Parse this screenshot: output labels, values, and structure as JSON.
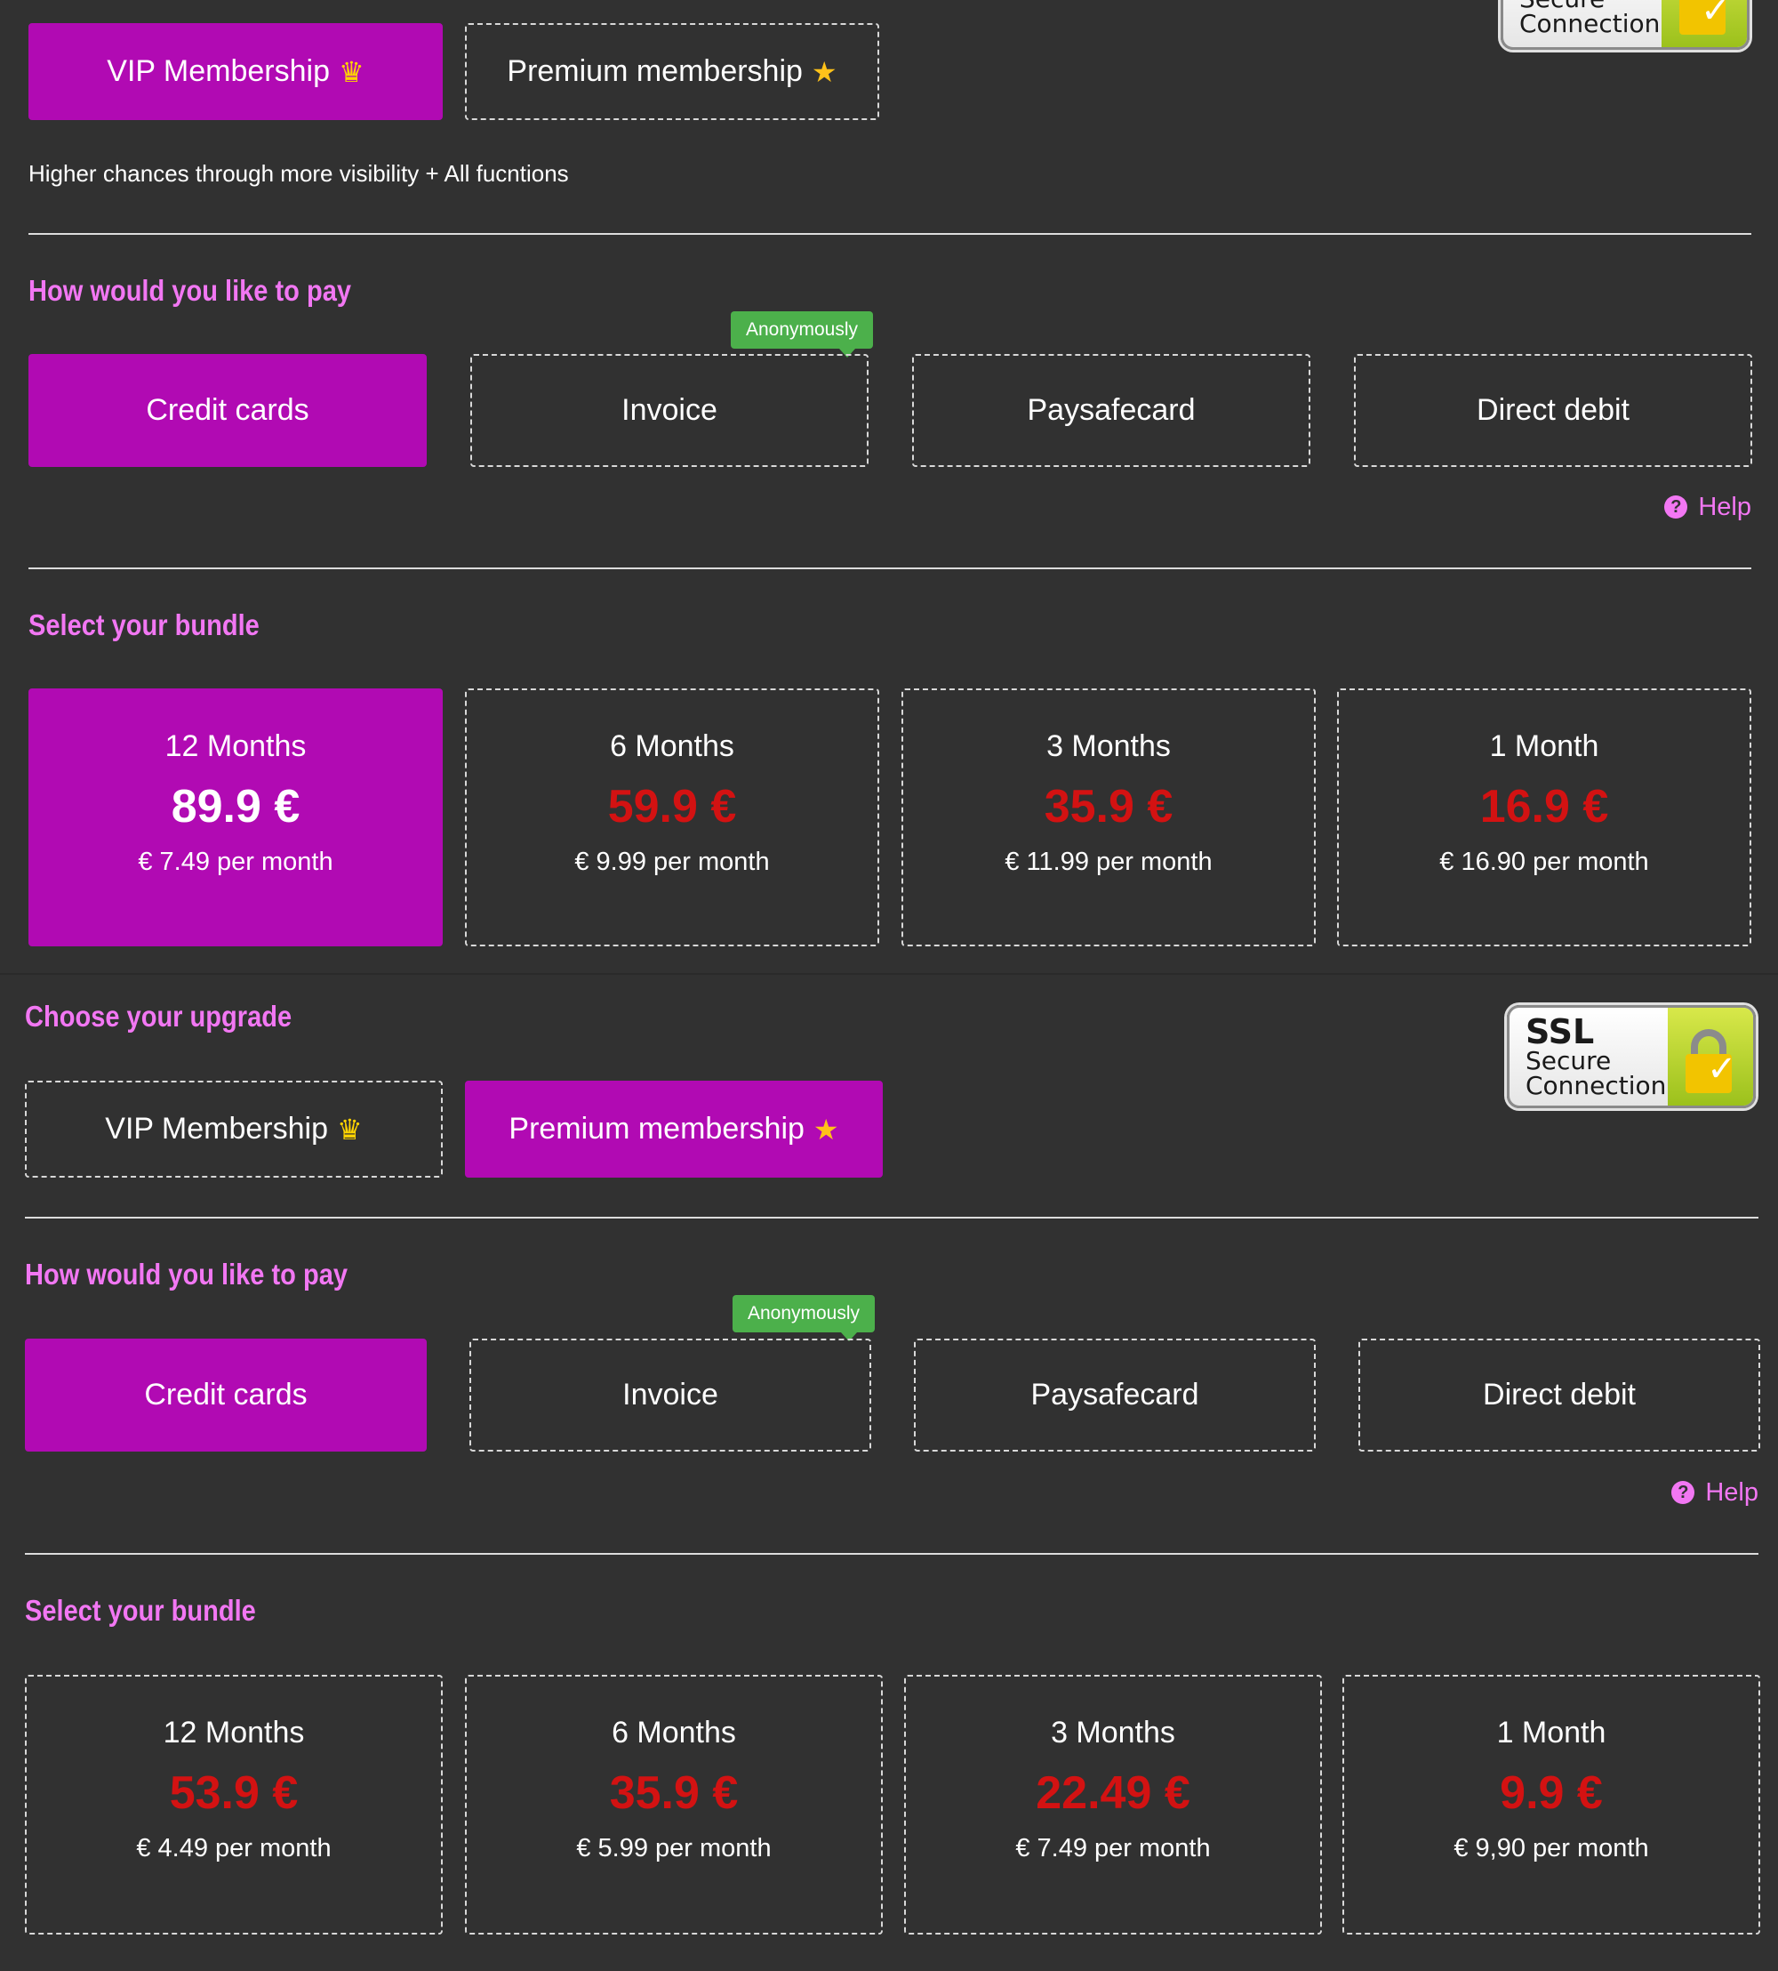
{
  "top": {
    "membership": {
      "vip_label": "VIP Membership",
      "premium_label": "Premium membership",
      "description": "Higher chances through more visibility + All fucntions"
    },
    "ssl": {
      "line2": "Secure",
      "line3": "Connection"
    },
    "payment": {
      "title": "How would you like to pay",
      "badge": "Anonymously",
      "options": [
        "Credit cards",
        "Invoice",
        "Paysafecard",
        "Direct debit"
      ],
      "help": "Help"
    },
    "bundle": {
      "title": "Select your bundle",
      "items": [
        {
          "months": "12 Months",
          "price": "89.9 €",
          "per_month": "€ 7.49 per month"
        },
        {
          "months": "6 Months",
          "price": "59.9 €",
          "per_month": "€ 9.99 per month"
        },
        {
          "months": "3 Months",
          "price": "35.9 €",
          "per_month": "€ 11.99 per month"
        },
        {
          "months": "1 Month",
          "price": "16.9 €",
          "per_month": "€ 16.90 per month"
        }
      ]
    }
  },
  "bottom": {
    "upgrade_title": "Choose your upgrade",
    "membership": {
      "vip_label": "VIP Membership",
      "premium_label": "Premium membership"
    },
    "ssl": {
      "line1": "SSL",
      "line2": "Secure",
      "line3": "Connection"
    },
    "payment": {
      "title": "How would you like to pay",
      "badge": "Anonymously",
      "options": [
        "Credit cards",
        "Invoice",
        "Paysafecard",
        "Direct debit"
      ],
      "help": "Help"
    },
    "bundle": {
      "title": "Select your bundle",
      "items": [
        {
          "months": "12 Months",
          "price": "53.9 €",
          "per_month": "€ 4.49 per month"
        },
        {
          "months": "6 Months",
          "price": "35.9 €",
          "per_month": "€ 5.99 per month"
        },
        {
          "months": "3 Months",
          "price": "22.49 €",
          "per_month": "€ 7.49 per month"
        },
        {
          "months": "1 Month",
          "price": "9.9 €",
          "per_month": "€ 9,90 per month"
        }
      ]
    }
  },
  "colors": {
    "background": "#313131",
    "accent_magenta": "#b10ab3",
    "heading_pink": "#f277f3",
    "price_red": "#d31212",
    "badge_green": "#4cb04b"
  },
  "icons": [
    "crown-icon",
    "star-icon",
    "help-circle-icon",
    "padlock-icon",
    "checkmark-icon"
  ]
}
